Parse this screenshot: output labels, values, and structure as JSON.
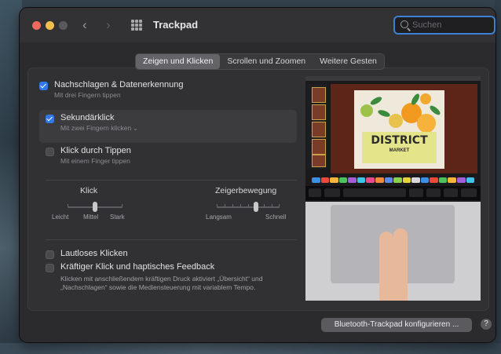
{
  "window": {
    "title": "Trackpad"
  },
  "search": {
    "placeholder": "Suchen"
  },
  "tabs": [
    {
      "label": "Zeigen und Klicken",
      "active": true
    },
    {
      "label": "Scrollen und Zoomen",
      "active": false
    },
    {
      "label": "Weitere Gesten",
      "active": false
    }
  ],
  "options": [
    {
      "title": "Nachschlagen & Datenerkennung",
      "subtitle": "Mit drei Fingern tippen",
      "checked": true
    },
    {
      "title": "Sekundärklick",
      "subtitle": "Mit zwei Fingern klicken",
      "checked": true
    },
    {
      "title": "Klick durch Tippen",
      "subtitle": "Mit einem Finger tippen",
      "checked": false
    }
  ],
  "click_slider": {
    "label": "Klick",
    "scale": [
      "Leicht",
      "Mittel",
      "Stark"
    ],
    "selected": "Mittel"
  },
  "tracking_slider": {
    "label": "Zeigerbewegung",
    "min_label": "Langsam",
    "max_label": "Schnell",
    "level": 0.63
  },
  "bottom_options": [
    {
      "title": "Lautloses Klicken",
      "checked": false
    },
    {
      "title": "Kräftiger Klick und haptisches Feedback",
      "checked": false
    }
  ],
  "force_click_description": "Klicken mit anschließendem kräftigen Druck aktiviert „Übersicht“ und „Nachschlagen“ sowie die Mediensteuerung mit variablem Tempo.",
  "preview": {
    "poster_title": "DISTRICT",
    "poster_subtitle": "MARKET"
  },
  "buttons": {
    "configure": "Bluetooth-Trackpad konfigurieren ...",
    "help": "?"
  },
  "colors": {
    "accent": "#2f7ae5",
    "search_focus": "#3d7fd4",
    "window_bg": "#2b2b2d"
  }
}
